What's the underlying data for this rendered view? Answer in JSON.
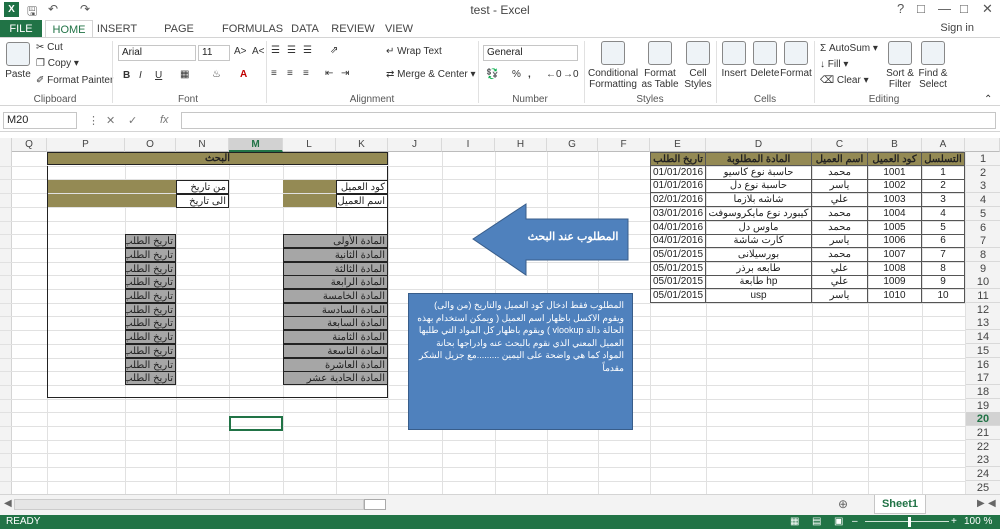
{
  "app": {
    "title": "test - Excel",
    "signin": "Sign in",
    "help": "?"
  },
  "tabs": [
    "FILE",
    "HOME",
    "INSERT",
    "PAGE LAYOUT",
    "FORMULAS",
    "DATA",
    "REVIEW",
    "VIEW"
  ],
  "clipboard": {
    "paste": "Paste",
    "cut": "Cut",
    "copy": "Copy",
    "format_painter": "Format Painter",
    "label": "Clipboard"
  },
  "font": {
    "name": "Arial",
    "size": "11",
    "label": "Font",
    "bold": "B",
    "italic": "I",
    "underline": "U"
  },
  "alignment": {
    "wrap": "Wrap Text",
    "merge": "Merge & Center",
    "label": "Alignment"
  },
  "number": {
    "format": "General",
    "label": "Number",
    "percent": "%",
    "comma": ","
  },
  "styles": {
    "cond": "Conditional Formatting",
    "format_table": "Format as Table",
    "cell_styles": "Cell Styles",
    "label": "Styles"
  },
  "cells": {
    "insert": "Insert",
    "delete": "Delete",
    "format": "Format",
    "label": "Cells"
  },
  "editing": {
    "autosum": "AutoSum",
    "fill": "Fill",
    "clear": "Clear",
    "sort": "Sort & Filter",
    "find": "Find & Select",
    "label": "Editing"
  },
  "formula_bar": {
    "name_box": "M20",
    "fx": "fx",
    "content": ""
  },
  "columns": [
    "Q",
    "P",
    "O",
    "N",
    "M",
    "L",
    "K",
    "J",
    "I",
    "H",
    "G",
    "F",
    "E",
    "D",
    "C",
    "B",
    "A"
  ],
  "selected_column": "M",
  "rows": [
    "1",
    "2",
    "3",
    "4",
    "5",
    "6",
    "7",
    "8",
    "9",
    "10",
    "11",
    "12",
    "13",
    "14",
    "15",
    "16",
    "17",
    "18",
    "19",
    "20",
    "21",
    "22",
    "23",
    "24",
    "25"
  ],
  "selected_row": "20",
  "search_form": {
    "header": "البحث",
    "from_date": "من تاريخ",
    "to_date": "الى تاريخ",
    "customer_code": "كود العميل",
    "customer_name": "اسم العميل",
    "items": [
      "المادة الأولى",
      "المادة الثانية",
      "المادة الثالثة",
      "المادة الرابعة",
      "المادة الخامسة",
      "المادة السادسة",
      "المادة السابعة",
      "المادة الثامنة",
      "المادة التاسعة",
      "المادة العاشرة",
      "المادة الحادية عشر"
    ],
    "order_date_label": "تاريخ الطلب"
  },
  "arrow_label": "المطلوب عند البحث",
  "note_text": "المطلوب فقط ادخال كود العميل والتاريخ (من والى) ويقوم الاكسل باظهار اسم العميل ( ويمكن استخدام بهذه الحالة دالة vlookup ) ويقوم باظهار كل المواد التي طلبها العميل المعني الذي نقوم بالبحث عنه وادراجها بحانة المواد كما هي واضحة على اليمين .........مع جزيل الشكر مقدماً",
  "data_table": {
    "headers": [
      "التسلسل",
      "كود العميل",
      "اسم العميل",
      "المادة المطلوبة",
      "تاريخ الطلب"
    ],
    "rows": [
      [
        "1",
        "1001",
        "محمد",
        "حاسبة نوع كاسيو",
        "01/01/2016"
      ],
      [
        "2",
        "1002",
        "ياسر",
        "حاسبة نوع دل",
        "01/01/2016"
      ],
      [
        "3",
        "1003",
        "علي",
        "شاشه بلازما",
        "02/01/2016"
      ],
      [
        "4",
        "1004",
        "محمد",
        "كيبورد نوع مايكروسوفت",
        "03/01/2016"
      ],
      [
        "5",
        "1005",
        "محمد",
        "ماوس دل",
        "04/01/2016"
      ],
      [
        "6",
        "1006",
        "ياسر",
        "كارت شاشة",
        "04/01/2016"
      ],
      [
        "7",
        "1007",
        "محمد",
        "بورسيلانى",
        "05/01/2015"
      ],
      [
        "8",
        "1008",
        "علي",
        "طابعه برذر",
        "05/01/2015"
      ],
      [
        "9",
        "1009",
        "علي",
        "طابعة hp",
        "05/01/2015"
      ],
      [
        "10",
        "1010",
        "ياسر",
        "usp",
        "05/01/2015"
      ]
    ]
  },
  "sheet_tab": "Sheet1",
  "status": {
    "ready": "READY",
    "zoom": "100 %"
  }
}
